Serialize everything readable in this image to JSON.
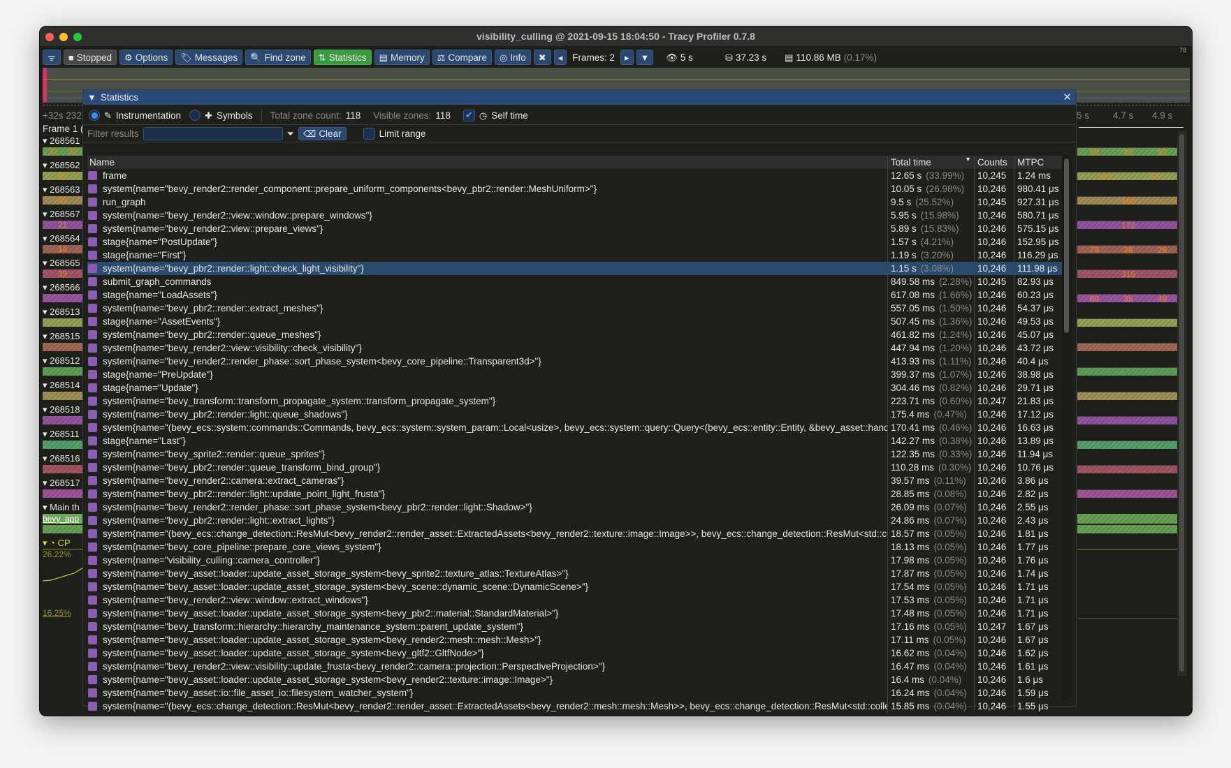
{
  "window": {
    "title": "visibility_culling @ 2021-09-15 18:04:50 - Tracy Profiler 0.7.8"
  },
  "toolbar": {
    "buttons": [
      {
        "icon": "wifi-icon",
        "label": ""
      },
      {
        "icon": "stop-icon",
        "label": "Stopped"
      },
      {
        "icon": "gear-icon",
        "label": "Options"
      },
      {
        "icon": "tags-icon",
        "label": "Messages"
      },
      {
        "icon": "search-icon",
        "label": "Find zone"
      },
      {
        "icon": "sort-icon",
        "label": "Statistics",
        "active": true
      },
      {
        "icon": "memory-icon",
        "label": "Memory"
      },
      {
        "icon": "scale-icon",
        "label": "Compare"
      },
      {
        "icon": "fingerprint-icon",
        "label": "Info"
      },
      {
        "icon": "tools-icon",
        "label": ""
      }
    ],
    "frames_label": "Frames: 2",
    "view_time": "5 s",
    "total_time": "37.23 s",
    "memory": "110.86 MB",
    "memory_pct": "(0.17%)",
    "fps": "78"
  },
  "timeline": {
    "ruler_left": "+32s 232",
    "ruler_right": [
      "5 s",
      "4.7 s",
      "4.9 s"
    ],
    "frame_label": "Frame 1 (",
    "threads": [
      "268561",
      "268562",
      "268563",
      "268567",
      "268564",
      "268565",
      "268566",
      "268513",
      "268515",
      "268512",
      "268514",
      "268518",
      "268511",
      "268516",
      "268517",
      "Main th"
    ],
    "thread_colors": [
      "#6fa85a",
      "#9aa85a",
      "#a8905a",
      "#9a58a8",
      "#a8685a",
      "#a85a70",
      "#a058a8",
      "#9aa85a",
      "#a8705a",
      "#60a85a",
      "#a8985a",
      "#9a58a8",
      "#58a870",
      "#a85a68",
      "#a858a0",
      "#6fa85a"
    ],
    "left_labels": [
      [
        "32",
        "39"
      ],
      [
        "45"
      ],
      [
        "65"
      ],
      [
        "21"
      ],
      [
        "14"
      ],
      [
        "39"
      ],
      [],
      [],
      [],
      [],
      [],
      [],
      [],
      [],
      [],
      []
    ],
    "right_labels": [
      [
        "59",
        "46",
        "59"
      ],
      [
        "180",
        "53"
      ],
      [
        "163"
      ],
      [
        "172"
      ],
      [
        "79",
        "36",
        "26"
      ],
      [
        "315"
      ],
      [
        "69",
        "35",
        "48"
      ],
      [],
      [],
      [],
      [],
      [],
      [],
      [],
      [],
      []
    ],
    "main_zone": "bevy_app",
    "cpu_label": "CP",
    "cpu_max": "26.22%",
    "cpu_min": "16.25%"
  },
  "stats": {
    "title": "Statistics",
    "mode_instrumentation": "Instrumentation",
    "mode_symbols": "Symbols",
    "total_zone_count_label": "Total zone count:",
    "total_zone_count": "118",
    "visible_zones_label": "Visible zones:",
    "visible_zones": "118",
    "self_time_label": "Self time",
    "self_time_checked": true,
    "filter_label": "Filter results",
    "filter_value": "",
    "clear_label": "Clear",
    "limit_range_label": "Limit range",
    "columns": [
      "Name",
      "Total time",
      "Counts",
      "MTPC"
    ],
    "sort_column": "Total time",
    "selected_row": 7,
    "zone_color": "#8a5cb2",
    "rows": [
      [
        "frame",
        "12.65 s",
        "(33.99%)",
        "10,245",
        "1.24 ms"
      ],
      [
        "system{name=\"bevy_render2::render_component::prepare_uniform_components<bevy_pbr2::render::MeshUniform>\"}",
        "10.05 s",
        "(26.98%)",
        "10,246",
        "980.41 μs"
      ],
      [
        "run_graph",
        "9.5 s",
        "(25.52%)",
        "10,245",
        "927.31 μs"
      ],
      [
        "system{name=\"bevy_render2::view::window::prepare_windows\"}",
        "5.95 s",
        "(15.98%)",
        "10,246",
        "580.71 μs"
      ],
      [
        "system{name=\"bevy_render2::view::prepare_views\"}",
        "5.89 s",
        "(15.83%)",
        "10,246",
        "575.15 μs"
      ],
      [
        "stage{name=\"PostUpdate\"}",
        "1.57 s",
        "(4.21%)",
        "10,246",
        "152.95 μs"
      ],
      [
        "stage{name=\"First\"}",
        "1.19 s",
        "(3.20%)",
        "10,246",
        "116.29 μs"
      ],
      [
        "system{name=\"bevy_pbr2::render::light::check_light_visibility\"}",
        "1.15 s",
        "(3.08%)",
        "10,246",
        "111.98 μs"
      ],
      [
        "submit_graph_commands",
        "849.58 ms",
        "(2.28%)",
        "10,245",
        "82.93 μs"
      ],
      [
        "stage{name=\"LoadAssets\"}",
        "617.08 ms",
        "(1.66%)",
        "10,246",
        "60.23 μs"
      ],
      [
        "system{name=\"bevy_pbr2::render::extract_meshes\"}",
        "557.05 ms",
        "(1.50%)",
        "10,246",
        "54.37 μs"
      ],
      [
        "stage{name=\"AssetEvents\"}",
        "507.45 ms",
        "(1.36%)",
        "10,246",
        "49.53 μs"
      ],
      [
        "system{name=\"bevy_pbr2::render::queue_meshes\"}",
        "461.82 ms",
        "(1.24%)",
        "10,246",
        "45.07 μs"
      ],
      [
        "system{name=\"bevy_render2::view::visibility::check_visibility\"}",
        "447.94 ms",
        "(1.20%)",
        "10,246",
        "43.72 μs"
      ],
      [
        "system{name=\"bevy_render2::render_phase::sort_phase_system<bevy_core_pipeline::Transparent3d>\"}",
        "413.93 ms",
        "(1.11%)",
        "10,246",
        "40.4 μs"
      ],
      [
        "stage{name=\"PreUpdate\"}",
        "399.37 ms",
        "(1.07%)",
        "10,246",
        "38.98 μs"
      ],
      [
        "stage{name=\"Update\"}",
        "304.46 ms",
        "(0.82%)",
        "10,246",
        "29.71 μs"
      ],
      [
        "system{name=\"bevy_transform::transform_propagate_system::transform_propagate_system\"}",
        "223.71 ms",
        "(0.60%)",
        "10,247",
        "21.83 μs"
      ],
      [
        "system{name=\"bevy_pbr2::render::light::queue_shadows\"}",
        "175.4 ms",
        "(0.47%)",
        "10,246",
        "17.12 μs"
      ],
      [
        "system{name=\"(bevy_ecs::system::commands::Commands, bevy_ecs::system::system_param::Local<usize>, bevy_ecs::system::query::Query<(bevy_ecs::entity::Entity, &bevy_asset::handle",
        "170.41 ms",
        "(0.46%)",
        "10,246",
        "16.63 μs"
      ],
      [
        "stage{name=\"Last\"}",
        "142.27 ms",
        "(0.38%)",
        "10,246",
        "13.89 μs"
      ],
      [
        "system{name=\"bevy_sprite2::render::queue_sprites\"}",
        "122.35 ms",
        "(0.33%)",
        "10,246",
        "11.94 μs"
      ],
      [
        "system{name=\"bevy_pbr2::render::queue_transform_bind_group\"}",
        "110.28 ms",
        "(0.30%)",
        "10,246",
        "10.76 μs"
      ],
      [
        "system{name=\"bevy_render2::camera::extract_cameras\"}",
        "39.57 ms",
        "(0.11%)",
        "10,246",
        "3.86 μs"
      ],
      [
        "system{name=\"bevy_pbr2::render::light::update_point_light_frusta\"}",
        "28.85 ms",
        "(0.08%)",
        "10,246",
        "2.82 μs"
      ],
      [
        "system{name=\"bevy_render2::render_phase::sort_phase_system<bevy_pbr2::render::light::Shadow>\"}",
        "26.09 ms",
        "(0.07%)",
        "10,246",
        "2.55 μs"
      ],
      [
        "system{name=\"bevy_pbr2::render::light::extract_lights\"}",
        "24.86 ms",
        "(0.07%)",
        "10,246",
        "2.43 μs"
      ],
      [
        "system{name=\"(bevy_ecs::change_detection::ResMut<bevy_render2::render_asset::ExtractedAssets<bevy_render2::texture::image::Image>>, bevy_ecs::change_detection::ResMut<std::collec",
        "18.57 ms",
        "(0.05%)",
        "10,246",
        "1.81 μs"
      ],
      [
        "system{name=\"bevy_core_pipeline::prepare_core_views_system\"}",
        "18.13 ms",
        "(0.05%)",
        "10,246",
        "1.77 μs"
      ],
      [
        "system{name=\"visibility_culling::camera_controller\"}",
        "17.98 ms",
        "(0.05%)",
        "10,246",
        "1.76 μs"
      ],
      [
        "system{name=\"bevy_asset::loader::update_asset_storage_system<bevy_sprite2::texture_atlas::TextureAtlas>\"}",
        "17.87 ms",
        "(0.05%)",
        "10,246",
        "1.74 μs"
      ],
      [
        "system{name=\"bevy_asset::loader::update_asset_storage_system<bevy_scene::dynamic_scene::DynamicScene>\"}",
        "17.54 ms",
        "(0.05%)",
        "10,246",
        "1.71 μs"
      ],
      [
        "system{name=\"bevy_render2::view::window::extract_windows\"}",
        "17.53 ms",
        "(0.05%)",
        "10,246",
        "1.71 μs"
      ],
      [
        "system{name=\"bevy_asset::loader::update_asset_storage_system<bevy_pbr2::material::StandardMaterial>\"}",
        "17.48 ms",
        "(0.05%)",
        "10,246",
        "1.71 μs"
      ],
      [
        "system{name=\"bevy_transform::hierarchy::hierarchy_maintenance_system::parent_update_system\"}",
        "17.16 ms",
        "(0.05%)",
        "10,247",
        "1.67 μs"
      ],
      [
        "system{name=\"bevy_asset::loader::update_asset_storage_system<bevy_render2::mesh::mesh::Mesh>\"}",
        "17.11 ms",
        "(0.05%)",
        "10,246",
        "1.67 μs"
      ],
      [
        "system{name=\"bevy_asset::loader::update_asset_storage_system<bevy_gltf2::GltfNode>\"}",
        "16.62 ms",
        "(0.04%)",
        "10,246",
        "1.62 μs"
      ],
      [
        "system{name=\"bevy_render2::view::visibility::update_frusta<bevy_render2::camera::projection::PerspectiveProjection>\"}",
        "16.47 ms",
        "(0.04%)",
        "10,246",
        "1.61 μs"
      ],
      [
        "system{name=\"bevy_asset::loader::update_asset_storage_system<bevy_render2::texture::image::Image>\"}",
        "16.4 ms",
        "(0.04%)",
        "10,246",
        "1.6 μs"
      ],
      [
        "system{name=\"bevy_asset::io::file_asset_io::filesystem_watcher_system\"}",
        "16.24 ms",
        "(0.04%)",
        "10,246",
        "1.59 μs"
      ],
      [
        "system{name=\"(bevy_ecs::change_detection::ResMut<bevy_render2::render_asset::ExtractedAssets<bevy_render2::mesh::mesh::Mesh>>, bevy_ecs::change_detection::ResMut<std::collectio",
        "15.85 ms",
        "(0.04%)",
        "10,246",
        "1.55 μs"
      ]
    ]
  }
}
